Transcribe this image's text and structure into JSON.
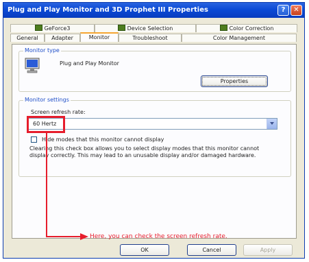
{
  "window": {
    "title": "Plug and Play Monitor and 3D Prophet III Properties",
    "help_label": "?",
    "close_label": "✕"
  },
  "tabs_top": [
    {
      "label": "GeForce3",
      "icon": "monitor-icon"
    },
    {
      "label": "Device Selection",
      "icon": "monitor-icon"
    },
    {
      "label": "Color Correction",
      "icon": "monitor-icon"
    }
  ],
  "tabs_bottom": [
    {
      "label": "General"
    },
    {
      "label": "Adapter"
    },
    {
      "label": "Monitor",
      "active": true
    },
    {
      "label": "Troubleshoot"
    },
    {
      "label": "Color Management"
    }
  ],
  "monitor_type": {
    "legend": "Monitor type",
    "name": "Plug and Play Monitor",
    "properties_label": "Properties"
  },
  "monitor_settings": {
    "legend": "Monitor settings",
    "refresh_label": "Screen refresh rate:",
    "refresh_value": "60 Hertz",
    "hide_modes_label": "Hide modes that this monitor cannot display",
    "hide_modes_checked": false,
    "description": "Clearing this check box allows you to select display modes that this monitor cannot display correctly. This may lead to an unusable display and/or damaged hardware."
  },
  "annotation": {
    "text": "Here, you can check the screen refresh rate.",
    "color": "#e61d2c"
  },
  "buttons": {
    "ok": "OK",
    "cancel": "Cancel",
    "apply": "Apply"
  }
}
